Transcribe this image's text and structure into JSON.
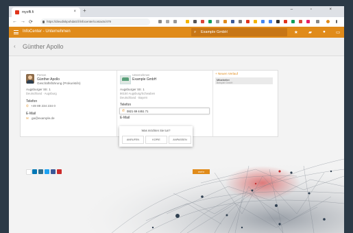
{
  "browser": {
    "tab_title": "myoffi.fi",
    "tab_close": "×",
    "new_tab": "+",
    "window_controls": "–  ▫  ×",
    "back": "←",
    "forward": "→",
    "reload": "⟳",
    "url": "https://dieudiskpohdatt.fi/infocenter/contacts/479"
  },
  "app": {
    "title": "InfoCenter - Unternehmen",
    "search_value": "Example GmbH",
    "accent": "#e08b1a"
  },
  "page": {
    "back": "‹",
    "title": "Günther Apollo"
  },
  "person": {
    "role_label": "Person",
    "name": "Günther Apollo",
    "position": "Geschäftsführung (Prokurist/in)",
    "address_line1": "Augsburger Str. 1",
    "address_line2": "Deutschland · Augsburg",
    "phone_label": "Telefon",
    "phone": "+49 89 234 234 0",
    "email_label": "E-Mail",
    "email": "ga@example.de"
  },
  "company": {
    "role_label": "Unternehmen",
    "name": "Example GmbH",
    "address_line1": "Augsburger Str. 1",
    "address_line2": "86150 Augsburg/Schwaben",
    "address_line3": "Deutschland · Bayern",
    "phone_label": "Telefon",
    "phone_value": "0821 69 4451 71",
    "email_label": "E-Mail"
  },
  "notes": {
    "header": "+ Neuen Verlauf",
    "tab": "Mitarbeiter",
    "row_label": "Mitarbeiter",
    "row_value": "Beispiel GmbH"
  },
  "popup": {
    "question": "Was möchten Sie tun?",
    "btn_call": "ANRUFEN",
    "btn_copy": "KOPIE",
    "btn_edit": "ANPASSEN"
  },
  "footer": {
    "more_button": "mehr"
  },
  "icons": {
    "tab_favicon": "red-square-icon",
    "phone": "phone-icon",
    "mail": "mail-icon"
  }
}
